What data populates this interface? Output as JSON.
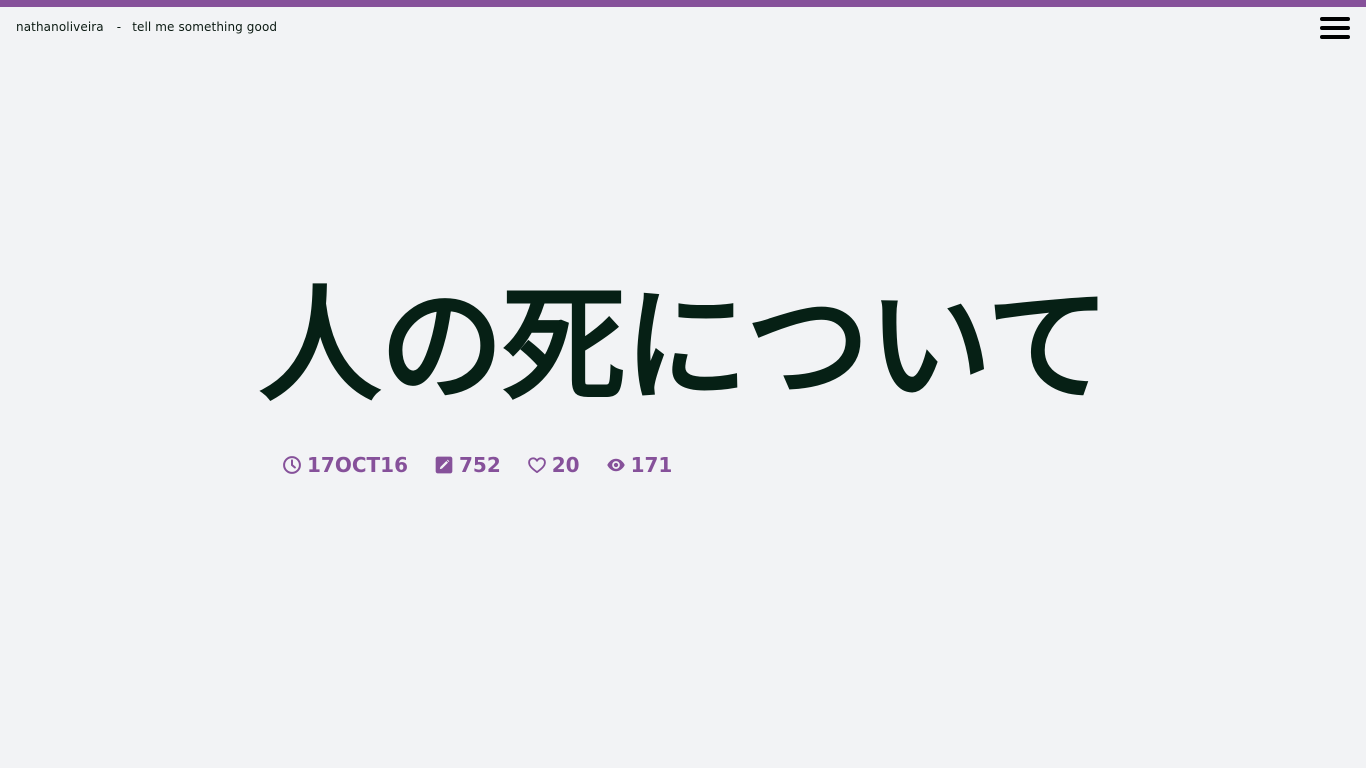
{
  "header": {
    "site_name": "nathanoliveira",
    "separator": "-",
    "tagline": "tell me something good"
  },
  "post": {
    "title": "人の死について",
    "date": "17OCT16",
    "word_count": "752",
    "likes": "20",
    "views": "171"
  },
  "icons": {
    "date": "clock-icon",
    "words": "edit-icon",
    "likes": "heart-icon",
    "views": "eye-icon",
    "menu": "hamburger-menu-icon"
  },
  "colors": {
    "accent": "#86519a",
    "title": "#062015",
    "background": "#f2f3f5"
  }
}
